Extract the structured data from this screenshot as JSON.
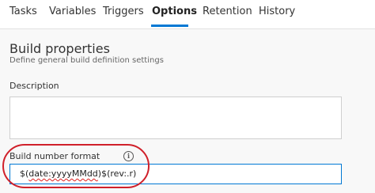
{
  "tabs": [
    {
      "label": "Tasks"
    },
    {
      "label": "Variables"
    },
    {
      "label": "Triggers"
    },
    {
      "label": "Options",
      "active": true
    },
    {
      "label": "Retention"
    },
    {
      "label": "History"
    }
  ],
  "build_properties": {
    "title": "Build properties",
    "subtitle": "Define general build definition settings"
  },
  "description": {
    "label": "Description",
    "value": ""
  },
  "build_number_format": {
    "label": "Build number format",
    "value_part1": "$(",
    "value_part2": "date:yyyyMMdd",
    "value_part3": ")$(rev:.r)"
  },
  "icons": {
    "info": "info-icon"
  },
  "colors": {
    "accent": "#0078d4",
    "highlight": "#d0202a"
  }
}
